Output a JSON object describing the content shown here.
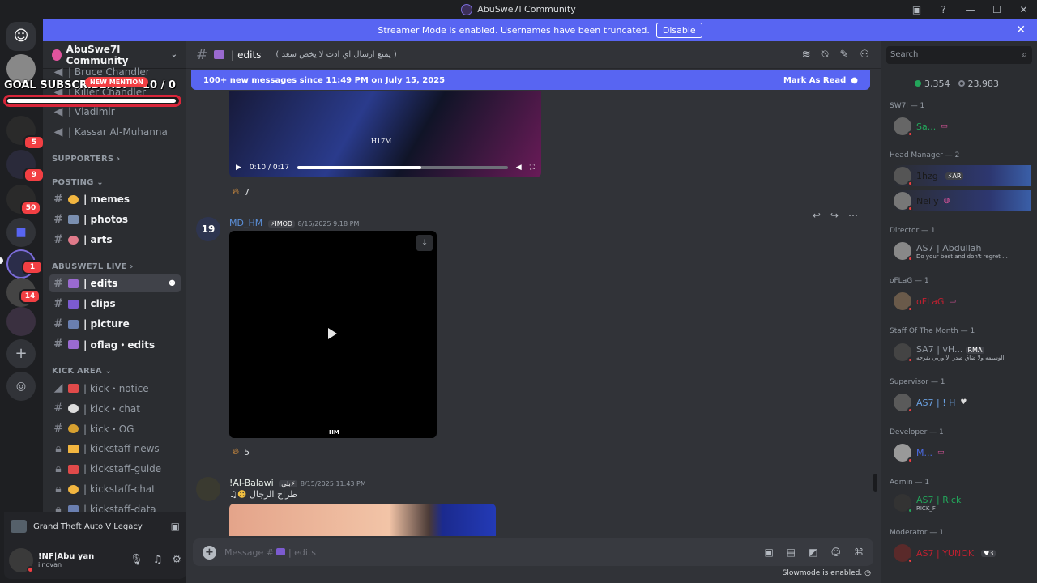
{
  "window": {
    "title": "AbuSwe7l Community"
  },
  "banner": {
    "text": "Streamer Mode is enabled. Usernames have been truncated.",
    "button": "Disable"
  },
  "guilds": {
    "badges": [
      "5",
      "9",
      "50",
      "1",
      "14"
    ]
  },
  "overlay": {
    "goal_label": "GOAL SUBSCRIBERS:",
    "goal_count": "10  / 0",
    "mention": "NEW MENTION",
    "progress": 0.98
  },
  "sidebar": {
    "server_name": "AbuSwe7l Community",
    "voice_channels": [
      "| Bruce Chandler",
      "| Killer Chandler",
      "| Vladimir",
      "| Kassar Al-Muhanna"
    ],
    "categories": {
      "supporters": "SUPPORTERS",
      "posting": "POSTING",
      "live": "ABUSWE7L LIVE",
      "kick": "KICK AREA"
    },
    "posting_channels": [
      "| memes",
      "| photos",
      "| arts"
    ],
    "live_channels": [
      "| edits",
      "| clips",
      "| picture",
      "| oflag・edits"
    ],
    "kick_channels": [
      "| kick・notice",
      "| kick・chat",
      "| kick・OG",
      "| kickstaff-news",
      "| kickstaff-guide",
      "| kickstaff-chat",
      "| kickstaff-data"
    ]
  },
  "activity": {
    "game": "Grand Theft Auto V Legacy"
  },
  "user": {
    "name": "!NF|Abu yan",
    "status": "iinovan"
  },
  "chat": {
    "channel": "| edits",
    "topic": "( يمنع ارسال اي ادت لا يخص سعد )",
    "new_messages": "100+ new messages since 11:49 PM on July 15, 2025",
    "mark_read": "Mark As Read",
    "video1": {
      "watermark": "H17M",
      "time": "0:10 / 0:17",
      "progress": 0.59,
      "reaction_count": "7"
    },
    "msg2": {
      "author": "MD_HM",
      "tag": "IMOD",
      "timestamp": "8/15/2025 9:18 PM",
      "reaction_count": "5",
      "watermark": "HM"
    },
    "msg3": {
      "author": "!Al-Balawi",
      "tag": "بلي",
      "timestamp": "8/15/2025 11:43 PM",
      "text": "طراح الرجال"
    },
    "input_placeholder": "Message #",
    "input_channel": "| edits",
    "slowmode": "Slowmode is enabled."
  },
  "members": {
    "search_placeholder": "Search",
    "online": "3,354",
    "total": "23,983",
    "sections": [
      {
        "title": "SW7l — 1",
        "members": [
          {
            "name": "Sa..."
          }
        ]
      },
      {
        "title": "Head Manager — 2",
        "members": [
          {
            "name": "1hzg",
            "badge": "AR"
          },
          {
            "name": "Nelly"
          }
        ]
      },
      {
        "title": "Director — 1",
        "members": [
          {
            "name": "AS7 | Abdullah",
            "sub": "Do your best and don't regret ..."
          }
        ]
      },
      {
        "title": "oFLaG — 1",
        "members": [
          {
            "name": "oFLaG"
          }
        ]
      },
      {
        "title": "Staff Of The Month — 1",
        "members": [
          {
            "name": "SA7 | vH...",
            "badge": "RMA",
            "sub": "الوسيمه ولا ضاق صدر الا وربي بفرجه"
          }
        ]
      },
      {
        "title": "Supervisor — 1",
        "members": [
          {
            "name": "AS7 | ! H"
          }
        ]
      },
      {
        "title": "Developer — 1",
        "members": [
          {
            "name": "M..."
          }
        ]
      },
      {
        "title": "Admin — 1",
        "members": [
          {
            "name": "AS7 | Rick",
            "sub": "RICK_F"
          }
        ]
      },
      {
        "title": "Moderator — 1",
        "members": [
          {
            "name": "AS7 | YUNOK",
            "badge": "3"
          }
        ]
      }
    ]
  },
  "colors": {
    "accent": "#5865f2",
    "bg": "#313338",
    "sidebar": "#2b2d31",
    "danger": "#f23f43"
  }
}
